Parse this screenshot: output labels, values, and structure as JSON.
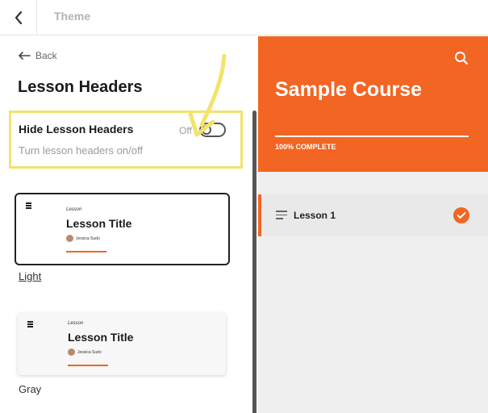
{
  "topbar": {
    "title": "Theme"
  },
  "left": {
    "back_label": "Back",
    "section_title": "Lesson Headers",
    "setting": {
      "label": "Hide Lesson Headers",
      "description": "Turn lesson headers on/off",
      "toggle_state": "Off"
    },
    "styles": [
      {
        "name": "Light",
        "preview": {
          "kicker": "Lesson",
          "title": "Lesson Title",
          "author": "Jessica Sudo"
        }
      },
      {
        "name": "Gray",
        "preview": {
          "kicker": "Lesson",
          "title": "Lesson Title",
          "author": "Jessica Sudo"
        }
      }
    ]
  },
  "preview": {
    "course_title": "Sample Course",
    "progress_text": "100% COMPLETE",
    "progress": 1.0,
    "lesson": {
      "label": "Lesson 1",
      "complete": true
    },
    "accent_color": "#f26522"
  },
  "annotation": {
    "color": "#f2e36b"
  }
}
